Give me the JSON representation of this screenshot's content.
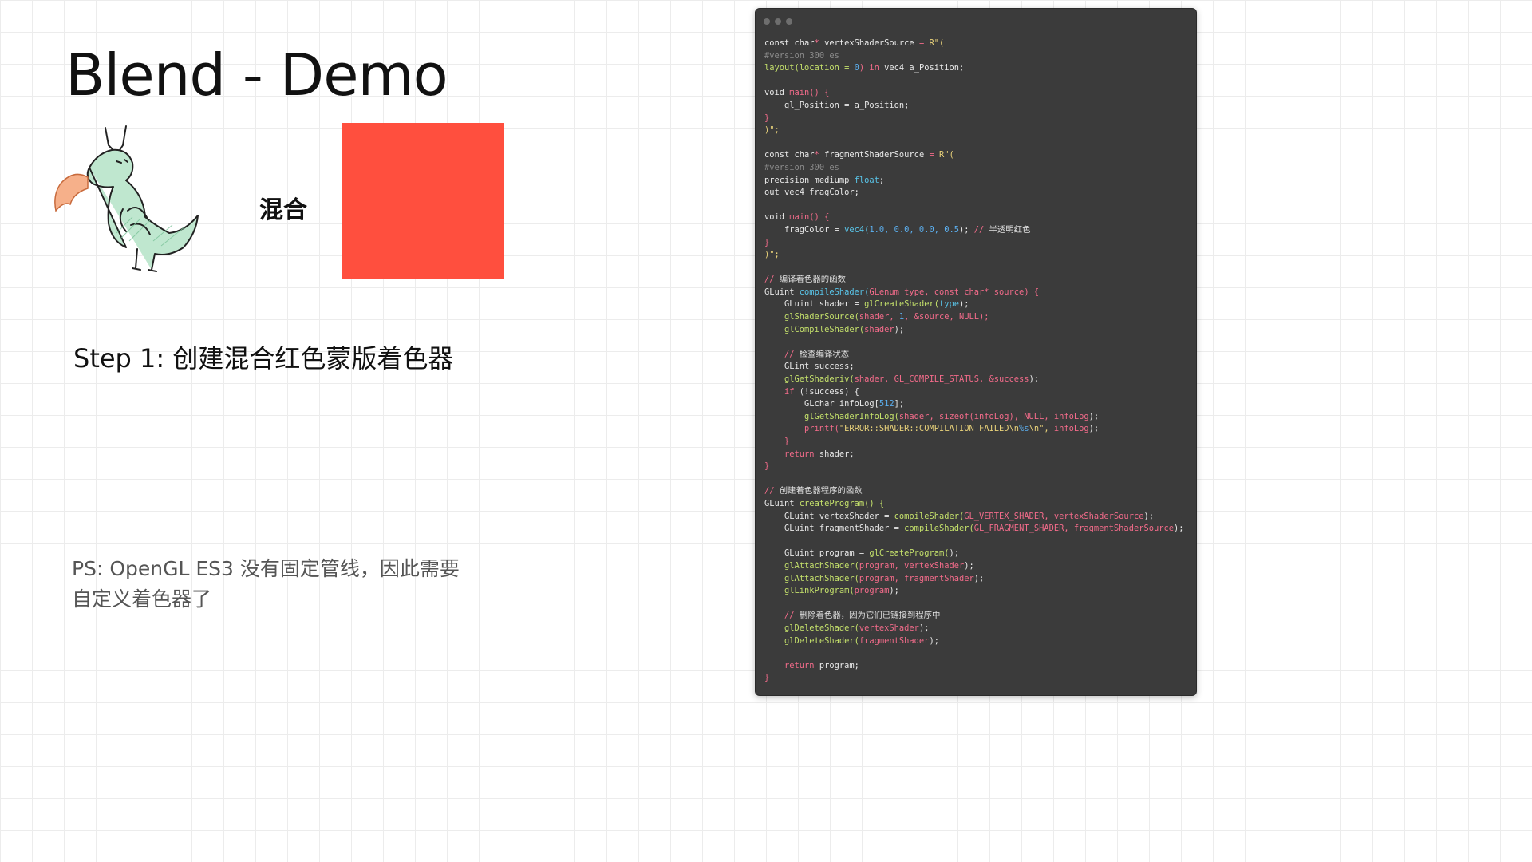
{
  "title": "Blend - Demo",
  "blend_label": "混合",
  "step": "Step 1: 创建混合红色蒙版着色器",
  "ps_line1": "PS: OpenGL ES3 没有固定管线，因此需要",
  "ps_line2": "自定义着色器了",
  "square_color": "#ff4f3e",
  "code_lines": [
    [
      [
        "const char",
        "tx"
      ],
      [
        "*",
        "kw"
      ],
      [
        " vertexShaderSource ",
        "tx"
      ],
      [
        "=",
        "kw"
      ],
      [
        " R\"(",
        "st"
      ]
    ],
    [
      [
        "#version 300 es",
        "cm"
      ]
    ],
    [
      [
        "layout(location = ",
        "fn"
      ],
      [
        "0",
        "nu"
      ],
      [
        ") in ",
        "kw"
      ],
      [
        "vec4 a_Position;",
        "tx"
      ]
    ],
    [],
    [
      [
        "void ",
        "tx"
      ],
      [
        "main() {",
        "kw"
      ]
    ],
    [
      [
        "    gl_Position = a_Position;",
        "tx"
      ]
    ],
    [
      [
        "}",
        "kw"
      ]
    ],
    [
      [
        ")\";",
        "st"
      ]
    ],
    [],
    [
      [
        "const char",
        "tx"
      ],
      [
        "*",
        "kw"
      ],
      [
        " fragmentShaderSource ",
        "tx"
      ],
      [
        "=",
        "kw"
      ],
      [
        " R\"(",
        "st"
      ]
    ],
    [
      [
        "#version 300 es",
        "cm"
      ]
    ],
    [
      [
        "precision mediump ",
        "tx"
      ],
      [
        "float",
        "ty"
      ],
      [
        ";",
        "tx"
      ]
    ],
    [
      [
        "out vec4 fragColor;",
        "tx"
      ]
    ],
    [],
    [
      [
        "void ",
        "tx"
      ],
      [
        "main() {",
        "kw"
      ]
    ],
    [
      [
        "    fragColor = ",
        "tx"
      ],
      [
        "vec4(",
        "ty"
      ],
      [
        "1.0, 0.0, 0.0, 0.5",
        "nu"
      ],
      [
        ");",
        "tx"
      ],
      [
        " // ",
        "kw"
      ],
      [
        "半透明红色",
        "cmt"
      ]
    ],
    [
      [
        "}",
        "kw"
      ]
    ],
    [
      [
        ")\";",
        "st"
      ]
    ],
    [],
    [
      [
        "// ",
        "kw"
      ],
      [
        "编译着色器的函数",
        "cmt"
      ]
    ],
    [
      [
        "GLuint ",
        "tx"
      ],
      [
        "compileShader(",
        "ty"
      ],
      [
        "GLenum type, const char* source) {",
        "kw"
      ]
    ],
    [
      [
        "    GLuint shader = ",
        "tx"
      ],
      [
        "glCreateShader(",
        "fn"
      ],
      [
        "type",
        "ty"
      ],
      [
        ");",
        "tx"
      ]
    ],
    [
      [
        "    glShaderSource(",
        "fn"
      ],
      [
        "shader, ",
        "kw"
      ],
      [
        "1",
        "nu"
      ],
      [
        ", &source, NULL);",
        "kw"
      ]
    ],
    [
      [
        "    glCompileShader(",
        "fn"
      ],
      [
        "shader",
        "kw"
      ],
      [
        ");",
        "tx"
      ]
    ],
    [],
    [
      [
        "    // ",
        "kw"
      ],
      [
        "检查编译状态",
        "cmt"
      ]
    ],
    [
      [
        "    GLint success;",
        "tx"
      ]
    ],
    [
      [
        "    glGetShaderiv(",
        "fn"
      ],
      [
        "shader, GL_COMPILE_STATUS, &success",
        "kw"
      ],
      [
        ");",
        "tx"
      ]
    ],
    [
      [
        "    if ",
        "kw"
      ],
      [
        "(!success) {",
        "tx"
      ]
    ],
    [
      [
        "        GLchar infoLog[",
        "tx"
      ],
      [
        "512",
        "nu"
      ],
      [
        "];",
        "tx"
      ]
    ],
    [
      [
        "        glGetShaderInfoLog(",
        "fn"
      ],
      [
        "shader, sizeof(infoLog), NULL, infoLog",
        "kw"
      ],
      [
        ");",
        "tx"
      ]
    ],
    [
      [
        "        printf(",
        "kw"
      ],
      [
        "\"ERROR::SHADER::COMPILATION_FAILED\\n",
        "st"
      ],
      [
        "%s",
        "nu"
      ],
      [
        "\\n\", ",
        "st"
      ],
      [
        "infoLog",
        "kw"
      ],
      [
        ");",
        "tx"
      ]
    ],
    [
      [
        "    }",
        "kw"
      ]
    ],
    [
      [
        "    return ",
        "kw"
      ],
      [
        "shader;",
        "tx"
      ]
    ],
    [
      [
        "}",
        "kw"
      ]
    ],
    [],
    [
      [
        "// ",
        "kw"
      ],
      [
        "创建着色器程序的函数",
        "cmt"
      ]
    ],
    [
      [
        "GLuint ",
        "tx"
      ],
      [
        "createProgram() {",
        "fn"
      ]
    ],
    [
      [
        "    GLuint vertexShader = ",
        "tx"
      ],
      [
        "compileShader(",
        "fn"
      ],
      [
        "GL_VERTEX_SHADER, vertexShaderSource",
        "kw"
      ],
      [
        ");",
        "tx"
      ]
    ],
    [
      [
        "    GLuint fragmentShader = ",
        "tx"
      ],
      [
        "compileShader(",
        "fn"
      ],
      [
        "GL_FRAGMENT_SHADER, fragmentShaderSource",
        "kw"
      ],
      [
        ");",
        "tx"
      ]
    ],
    [],
    [
      [
        "    GLuint program = ",
        "tx"
      ],
      [
        "glCreateProgram(",
        "fn"
      ],
      [
        ");",
        "tx"
      ]
    ],
    [
      [
        "    glAttachShader(",
        "fn"
      ],
      [
        "program, vertexShader",
        "kw"
      ],
      [
        ");",
        "tx"
      ]
    ],
    [
      [
        "    glAttachShader(",
        "fn"
      ],
      [
        "program, fragmentShader",
        "kw"
      ],
      [
        ");",
        "tx"
      ]
    ],
    [
      [
        "    glLinkProgram(",
        "fn"
      ],
      [
        "program",
        "kw"
      ],
      [
        ");",
        "tx"
      ]
    ],
    [],
    [
      [
        "    // ",
        "kw"
      ],
      [
        "删除着色器，因为它们已链接到程序中",
        "cmt"
      ]
    ],
    [
      [
        "    glDeleteShader(",
        "fn"
      ],
      [
        "vertexShader",
        "kw"
      ],
      [
        ");",
        "tx"
      ]
    ],
    [
      [
        "    glDeleteShader(",
        "fn"
      ],
      [
        "fragmentShader",
        "kw"
      ],
      [
        ");",
        "tx"
      ]
    ],
    [],
    [
      [
        "    return ",
        "kw"
      ],
      [
        "program;",
        "tx"
      ]
    ],
    [
      [
        "}",
        "kw"
      ]
    ]
  ]
}
